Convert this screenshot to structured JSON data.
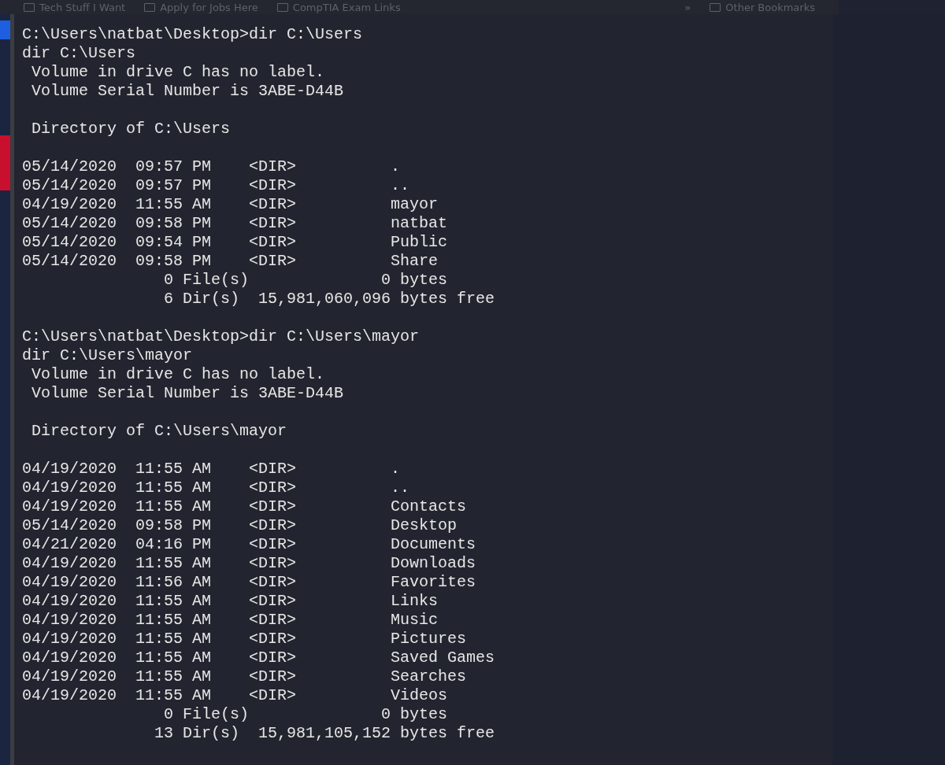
{
  "bookmarks_bar": {
    "items": [
      "Tech Stuff I Want",
      "Apply for Jobs Here",
      "CompTIA Exam Links"
    ],
    "overflow": "»",
    "other": "Other Bookmarks"
  },
  "terminal": {
    "blocks": [
      [
        "C:\\Users\\natbat\\Desktop>dir C:\\Users",
        "dir C:\\Users",
        " Volume in drive C has no label.",
        " Volume Serial Number is 3ABE-D44B"
      ],
      [
        " Directory of C:\\Users"
      ],
      [
        "05/14/2020  09:57 PM    <DIR>          .",
        "05/14/2020  09:57 PM    <DIR>          ..",
        "04/19/2020  11:55 AM    <DIR>          mayor",
        "05/14/2020  09:58 PM    <DIR>          natbat",
        "05/14/2020  09:54 PM    <DIR>          Public",
        "05/14/2020  09:58 PM    <DIR>          Share",
        "               0 File(s)              0 bytes",
        "               6 Dir(s)  15,981,060,096 bytes free"
      ],
      [
        "C:\\Users\\natbat\\Desktop>dir C:\\Users\\mayor",
        "dir C:\\Users\\mayor",
        " Volume in drive C has no label.",
        " Volume Serial Number is 3ABE-D44B"
      ],
      [
        " Directory of C:\\Users\\mayor"
      ],
      [
        "04/19/2020  11:55 AM    <DIR>          .",
        "04/19/2020  11:55 AM    <DIR>          ..",
        "04/19/2020  11:55 AM    <DIR>          Contacts",
        "05/14/2020  09:58 PM    <DIR>          Desktop",
        "04/21/2020  04:16 PM    <DIR>          Documents",
        "04/19/2020  11:55 AM    <DIR>          Downloads",
        "04/19/2020  11:56 AM    <DIR>          Favorites",
        "04/19/2020  11:55 AM    <DIR>          Links",
        "04/19/2020  11:55 AM    <DIR>          Music",
        "04/19/2020  11:55 AM    <DIR>          Pictures",
        "04/19/2020  11:55 AM    <DIR>          Saved Games",
        "04/19/2020  11:55 AM    <DIR>          Searches",
        "04/19/2020  11:55 AM    <DIR>          Videos",
        "               0 File(s)              0 bytes",
        "              13 Dir(s)  15,981,105,152 bytes free"
      ]
    ]
  }
}
